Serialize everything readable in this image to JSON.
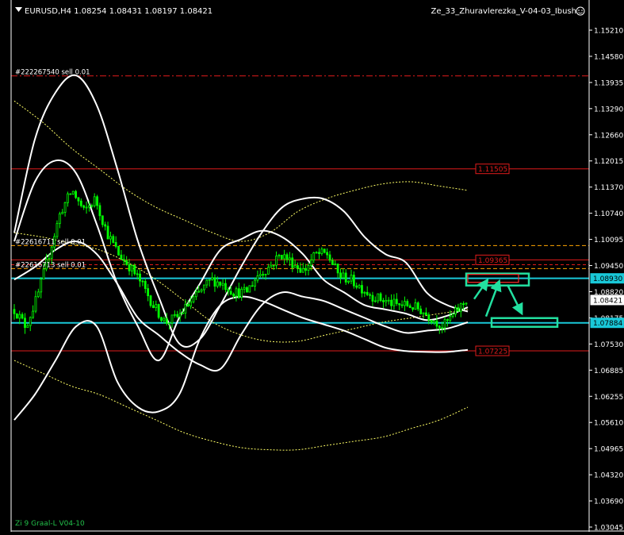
{
  "header": {
    "symbol_line": "EURUSD,H4  1.08254 1.08431 1.08197 1.08421",
    "expert_name": "Ze_33_Zhuravlerezka_V-04-03_Ibush",
    "footer_label": "Zi 9 Graal-L V04-10"
  },
  "colors": {
    "background": "#000000",
    "candle": "#00ff00",
    "bands": "#ffffff",
    "channel": "#ffff66",
    "level_red": "#ff2a2a",
    "level_orange": "#ffa500",
    "level_cyan": "#19c8d8",
    "annotation": "#22e0a0",
    "axis_text": "#ffffff"
  },
  "chart_data": {
    "type": "line",
    "instrument": "EURUSD",
    "timeframe": "H4",
    "ylim": [
      1.03045,
      1.154
    ],
    "y_ticks": [
      "1.15210",
      "1.14580",
      "1.13935",
      "1.13290",
      "1.12660",
      "1.12015",
      "1.11370",
      "1.10740",
      "1.10095",
      "1.09450",
      "1.08820",
      "1.08175",
      "1.07530",
      "1.06885",
      "1.06255",
      "1.05610",
      "1.04965",
      "1.04320",
      "1.03690",
      "1.03045"
    ],
    "price_labels": [
      {
        "text": "1.11505",
        "value": 1.11505,
        "style": "red"
      },
      {
        "text": "1.09365",
        "value": 1.09365,
        "style": "red"
      },
      {
        "text": "1.08930",
        "value": 1.0893,
        "style": "cyan"
      },
      {
        "text": "1.08421",
        "value": 1.08421,
        "style": "current"
      },
      {
        "text": "1.07884",
        "value": 1.07884,
        "style": "cyan"
      },
      {
        "text": "1.07225",
        "value": 1.07225,
        "style": "red"
      }
    ],
    "order_lines": [
      {
        "text": "#222267540 sell 0.01",
        "value": 1.1369,
        "style": "red-dashdot"
      },
      {
        "text": "#22616711 sell 0.01",
        "value": 1.097,
        "style": "orange-dash"
      },
      {
        "text": "#22616713 sell 0.01",
        "value": 1.0916,
        "style": "orange-dash"
      }
    ],
    "extra_levels": [
      {
        "value": 1.0925,
        "style": "red-dash"
      }
    ],
    "series": [
      {
        "key": "close",
        "values": [
          1.082,
          1.078,
          1.085,
          1.095,
          1.105,
          1.11,
          1.105,
          1.108,
          1.1,
          1.095,
          1.092,
          1.088,
          1.083,
          1.079,
          1.08,
          1.083,
          1.086,
          1.089,
          1.088,
          1.086,
          1.086,
          1.09,
          1.092,
          1.095,
          1.093,
          1.091,
          1.095,
          1.095,
          1.09,
          1.089,
          1.087,
          1.085,
          1.084,
          1.083,
          1.083,
          1.082,
          1.08,
          1.078,
          1.081,
          1.0842
        ]
      },
      {
        "key": "band_outer_upper",
        "values": [
          1.1,
          1.122,
          1.133,
          1.137,
          1.13,
          1.115,
          1.098,
          1.085,
          1.074,
          1.075,
          1.083,
          1.092,
          1.1,
          1.106,
          1.108,
          1.108,
          1.105,
          1.099,
          1.095,
          1.093,
          1.086,
          1.083,
          1.0815
        ]
      },
      {
        "key": "band_inner_upper",
        "values": [
          1.098,
          1.112,
          1.117,
          1.114,
          1.102,
          1.088,
          1.078,
          1.07,
          1.08,
          1.088,
          1.096,
          1.0985,
          1.1005,
          1.099,
          1.095,
          1.089,
          1.086,
          1.083,
          1.082,
          1.081,
          1.0795,
          1.0805,
          1.0825
        ]
      },
      {
        "key": "band_inner_lower",
        "values": [
          1.089,
          1.092,
          1.096,
          1.098,
          1.095,
          1.088,
          1.08,
          1.076,
          1.072,
          1.069,
          1.068,
          1.076,
          1.083,
          1.086,
          1.085,
          1.084,
          1.082,
          1.08,
          1.078,
          1.0765,
          1.077,
          1.0775,
          1.079
        ]
      },
      {
        "key": "band_outer_lower",
        "values": [
          1.056,
          1.062,
          1.07,
          1.078,
          1.078,
          1.065,
          1.059,
          1.058,
          1.062,
          1.075,
          1.083,
          1.085,
          1.084,
          1.082,
          1.08,
          1.0785,
          1.077,
          1.075,
          1.073,
          1.0722,
          1.072,
          1.072,
          1.0725
        ]
      },
      {
        "key": "channel_upper",
        "values": [
          1.131,
          1.126,
          1.12,
          1.115,
          1.11,
          1.106,
          1.103,
          1.1,
          1.098,
          1.1,
          1.105,
          1.108,
          1.11,
          1.1115,
          1.112,
          1.111,
          1.11
        ]
      },
      {
        "key": "channel_middle",
        "values": [
          1.1,
          1.099,
          1.0975,
          1.096,
          1.093,
          1.089,
          1.084,
          1.079,
          1.076,
          1.0745,
          1.0745,
          1.076,
          1.0775,
          1.079,
          1.08,
          1.081,
          1.082
        ]
      },
      {
        "key": "channel_lower",
        "values": [
          1.07,
          1.067,
          1.064,
          1.062,
          1.059,
          1.056,
          1.053,
          1.051,
          1.0495,
          1.049,
          1.049,
          1.05,
          1.051,
          1.052,
          1.054,
          1.056,
          1.059
        ]
      }
    ]
  }
}
